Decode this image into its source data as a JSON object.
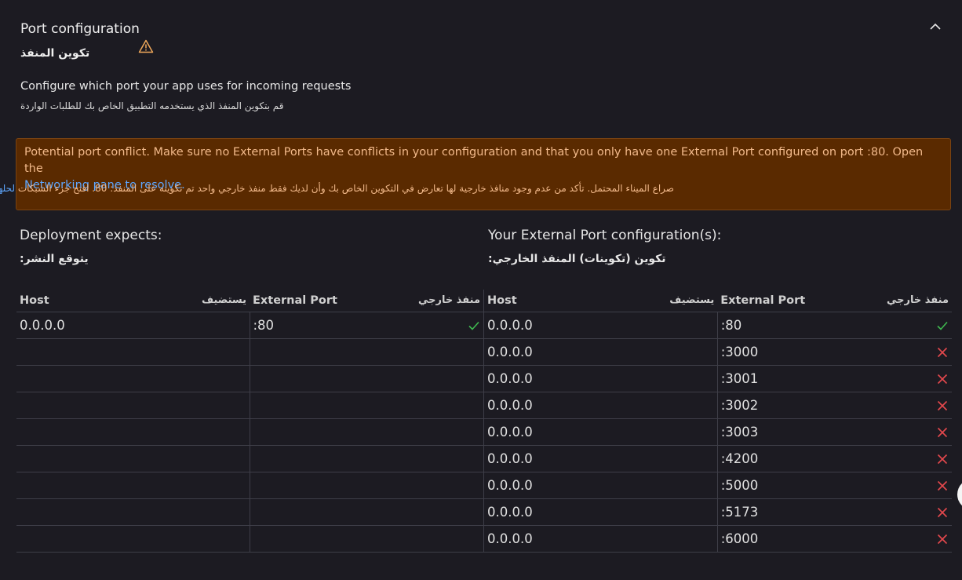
{
  "section": {
    "title": "Port configuration",
    "title_ar": "تكوين المنفذ",
    "description": "Configure which port your app uses for incoming requests",
    "description_ar": "قم بتكوين المنفذ الذي يستخدمه التطبيق الخاص بك للطلبات الواردة",
    "warning_icon": "warning-triangle-icon",
    "collapse_icon": "chevron-up-icon"
  },
  "banner": {
    "text": "Potential port conflict. Make sure no External Ports have conflicts in your configuration and that you only have one External Port configured on port :80. Open the",
    "link": "Networking pane to resolve.",
    "text_ar": "صراع الميناء المحتمل. تأكد من عدم وجود منافذ خارجية لها تعارض في التكوين الخاص بك وأن لديك فقط منفذ خارجي واحد تم تكوينه على المنفذ: 80. افتح جزء الشبكات",
    "link_ar": "لحلها",
    "trailing_ar": ".",
    "colors": {
      "background": "#5a2a00",
      "text": "#f2b98a",
      "link": "#5ea7ff"
    }
  },
  "deployment": {
    "heading": "Deployment expects:",
    "heading_ar": "يتوقع النشر:",
    "columns": {
      "host": "Host",
      "host_ar": "يستضيف",
      "port": "External Port",
      "port_ar": "منفذ خارجي"
    },
    "rows": [
      {
        "host": "0.0.0.0",
        "port": ":80",
        "status": "ok"
      }
    ]
  },
  "external": {
    "heading": "Your External Port configuration(s):",
    "heading_ar": "تكوين (تكوينات) المنفذ الخارجي:",
    "columns": {
      "host": "Host",
      "host_ar": "يستضيف",
      "port": "External Port",
      "port_ar": "منفذ خارجي"
    },
    "rows": [
      {
        "host": "0.0.0.0",
        "port": ":80",
        "status": "ok"
      },
      {
        "host": "0.0.0.0",
        "port": ":3000",
        "status": "conflict"
      },
      {
        "host": "0.0.0.0",
        "port": ":3001",
        "status": "conflict"
      },
      {
        "host": "0.0.0.0",
        "port": ":3002",
        "status": "conflict"
      },
      {
        "host": "0.0.0.0",
        "port": ":3003",
        "status": "conflict"
      },
      {
        "host": "0.0.0.0",
        "port": ":4200",
        "status": "conflict"
      },
      {
        "host": "0.0.0.0",
        "port": ":5000",
        "status": "conflict"
      },
      {
        "host": "0.0.0.0",
        "port": ":5173",
        "status": "conflict"
      },
      {
        "host": "0.0.0.0",
        "port": ":6000",
        "status": "conflict"
      }
    ]
  },
  "status_colors": {
    "ok": "#3fb950",
    "conflict": "#e5484d"
  }
}
